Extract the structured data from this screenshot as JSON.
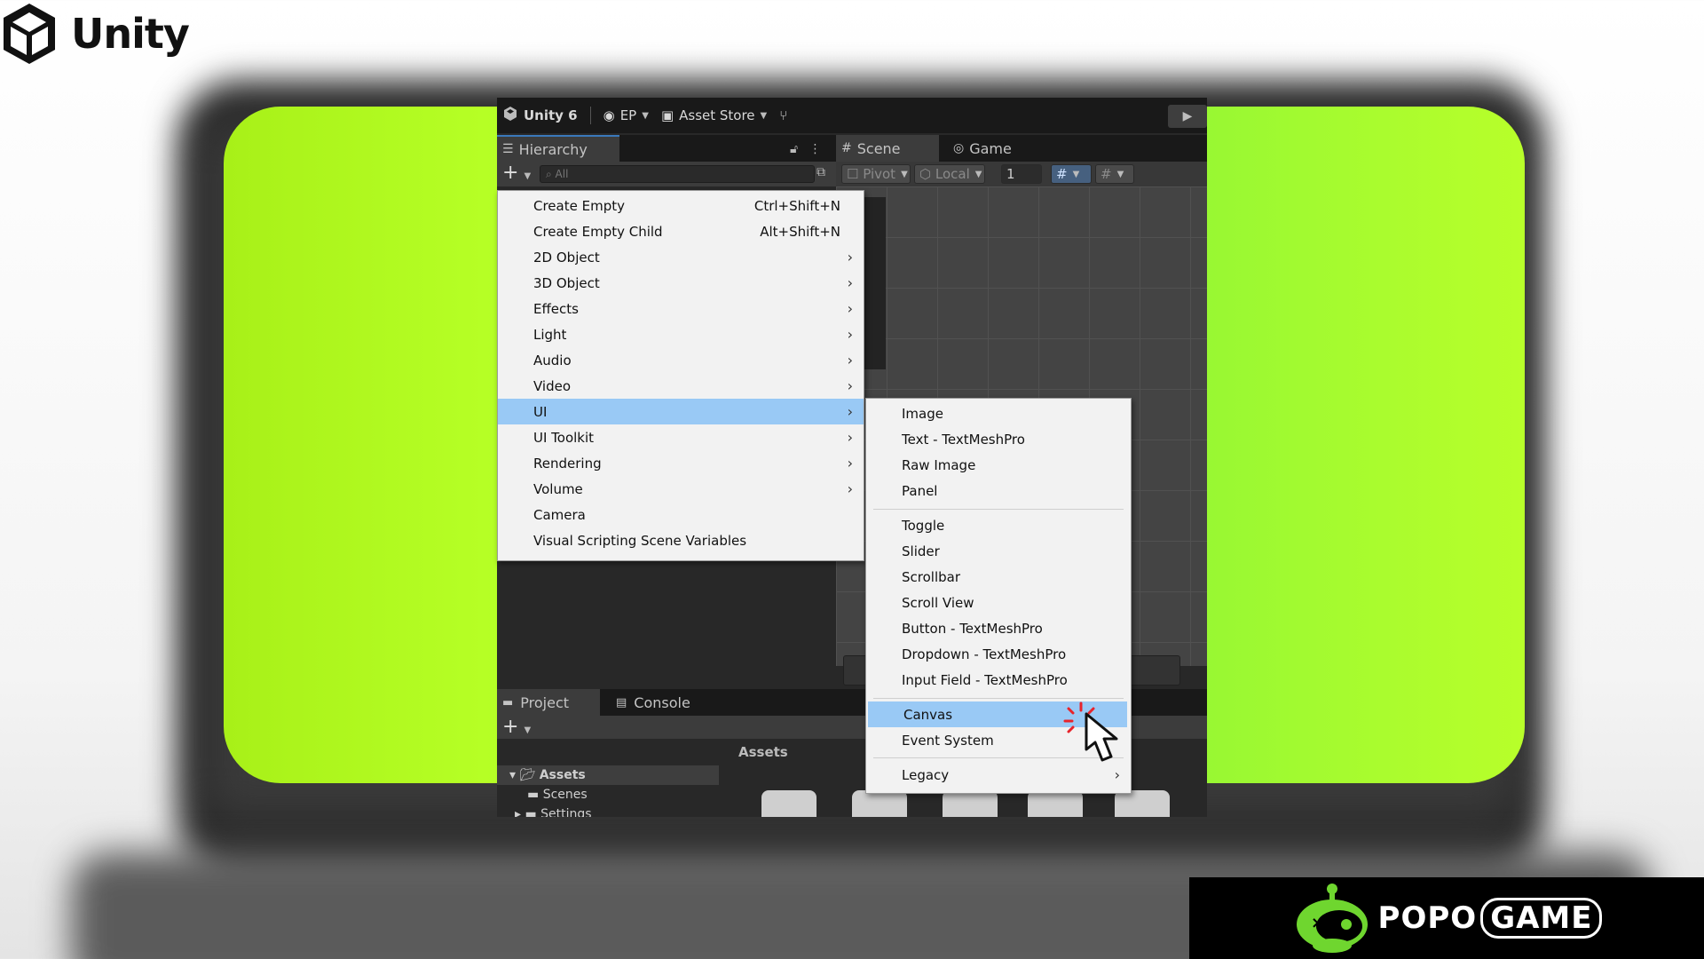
{
  "brand": {
    "name": "Unity"
  },
  "toolbar": {
    "unity_version": "Unity 6",
    "account": "EP",
    "asset_store": "Asset Store"
  },
  "hierarchy": {
    "tab_label": "Hierarchy",
    "search_placeholder": "All"
  },
  "scene": {
    "tab_scene": "Scene",
    "tab_game": "Game",
    "pivot_label": "Pivot",
    "local_label": "Local",
    "snap_value": "1"
  },
  "project": {
    "tab_project": "Project",
    "tab_console": "Console",
    "assets_header": "Assets",
    "tree": [
      "Assets",
      "Scenes",
      "Settings"
    ]
  },
  "create_menu": {
    "items": [
      {
        "label": "Create Empty",
        "shortcut": "Ctrl+Shift+N",
        "submenu": false
      },
      {
        "label": "Create Empty Child",
        "shortcut": "Alt+Shift+N",
        "submenu": false
      },
      {
        "label": "2D Object",
        "shortcut": "",
        "submenu": true
      },
      {
        "label": "3D Object",
        "shortcut": "",
        "submenu": true
      },
      {
        "label": "Effects",
        "shortcut": "",
        "submenu": true
      },
      {
        "label": "Light",
        "shortcut": "",
        "submenu": true
      },
      {
        "label": "Audio",
        "shortcut": "",
        "submenu": true
      },
      {
        "label": "Video",
        "shortcut": "",
        "submenu": true
      },
      {
        "label": "UI",
        "shortcut": "",
        "submenu": true,
        "highlighted": true
      },
      {
        "label": "UI Toolkit",
        "shortcut": "",
        "submenu": true
      },
      {
        "label": "Rendering",
        "shortcut": "",
        "submenu": true
      },
      {
        "label": "Volume",
        "shortcut": "",
        "submenu": true
      },
      {
        "label": "Camera",
        "shortcut": "",
        "submenu": false
      },
      {
        "label": "Visual Scripting Scene Variables",
        "shortcut": "",
        "submenu": false
      }
    ]
  },
  "ui_submenu": {
    "items": [
      {
        "label": "Image"
      },
      {
        "label": "Text - TextMeshPro"
      },
      {
        "label": "Raw Image"
      },
      {
        "label": "Panel"
      },
      {
        "label": "Toggle"
      },
      {
        "label": "Slider"
      },
      {
        "label": "Scrollbar"
      },
      {
        "label": "Scroll View"
      },
      {
        "label": "Button - TextMeshPro"
      },
      {
        "label": "Dropdown - TextMeshPro"
      },
      {
        "label": "Input Field - TextMeshPro"
      },
      {
        "label": "Canvas",
        "highlighted": true
      },
      {
        "label": "Event System"
      },
      {
        "label": "Legacy",
        "submenu": true
      }
    ]
  },
  "badge": {
    "name_part1": "POPO",
    "name_part2": "GAME"
  },
  "colors": {
    "green_panel": "#a8f018",
    "menu_highlight": "#99c9f5",
    "editor_bg": "#282828",
    "badge_green": "#6fd62f"
  }
}
